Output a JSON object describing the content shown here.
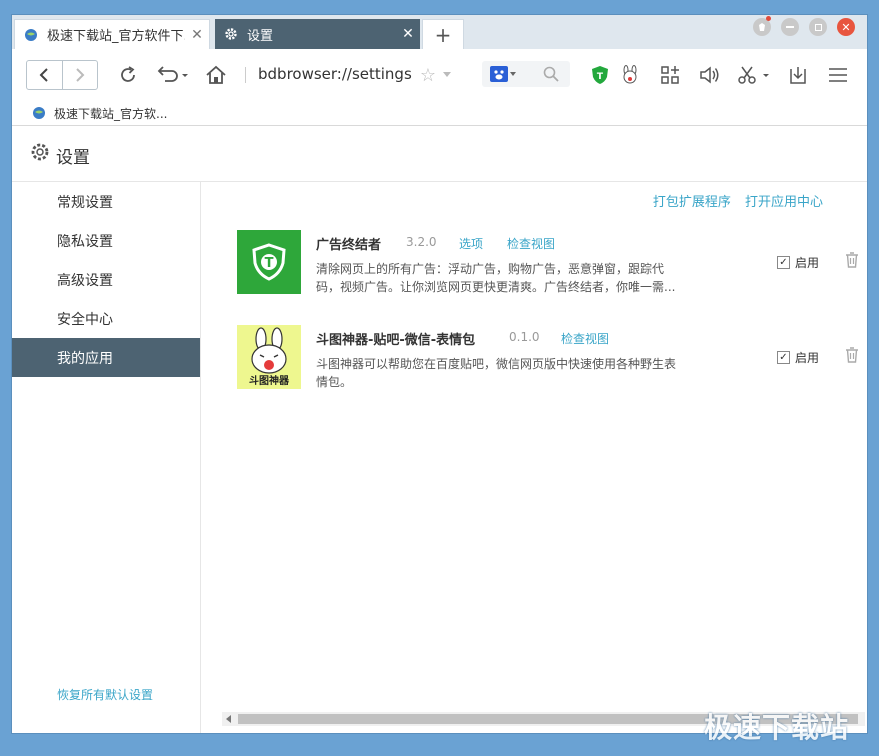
{
  "tabs": [
    {
      "label": "极速下载站_官方软件下...",
      "icon": "globe-icon"
    },
    {
      "label": "设置",
      "icon": "gear-icon"
    }
  ],
  "toolbar": {
    "url": "bdbrowser://settings"
  },
  "bookmarks": [
    {
      "label": "极速下载站_官方软..."
    }
  ],
  "settings": {
    "title": "设置"
  },
  "sidebar": {
    "items": [
      {
        "label": "常规设置"
      },
      {
        "label": "隐私设置"
      },
      {
        "label": "高级设置"
      },
      {
        "label": "安全中心"
      },
      {
        "label": "我的应用",
        "active": true
      }
    ],
    "restore": "恢复所有默认设置"
  },
  "content": {
    "links": {
      "pack": "打包扩展程序",
      "open_center": "打开应用中心"
    },
    "apps": [
      {
        "name": "广告终结者",
        "version": "3.2.0",
        "options": "选项",
        "inspect": "检查视图",
        "description": "清除网页上的所有广告：浮动广告，购物广告，恶意弹窗，跟踪代码，视频广告。让你浏览网页更快更清爽。广告终结者，你唯一需...",
        "enable_label": "启用",
        "enabled": true
      },
      {
        "name": "斗图神器-贴吧-微信-表情包",
        "version": "0.1.0",
        "inspect": "检查视图",
        "description": "斗图神器可以帮助您在百度贴吧，微信网页版中快速使用各种野生表情包。",
        "logo_text": "斗图神器",
        "enable_label": "启用",
        "enabled": true
      }
    ]
  },
  "watermark": "极速下载站",
  "colors": {
    "accent": "#3aa5c8",
    "active_tab": "#4d6372",
    "desktop": "#6aa2d3"
  }
}
